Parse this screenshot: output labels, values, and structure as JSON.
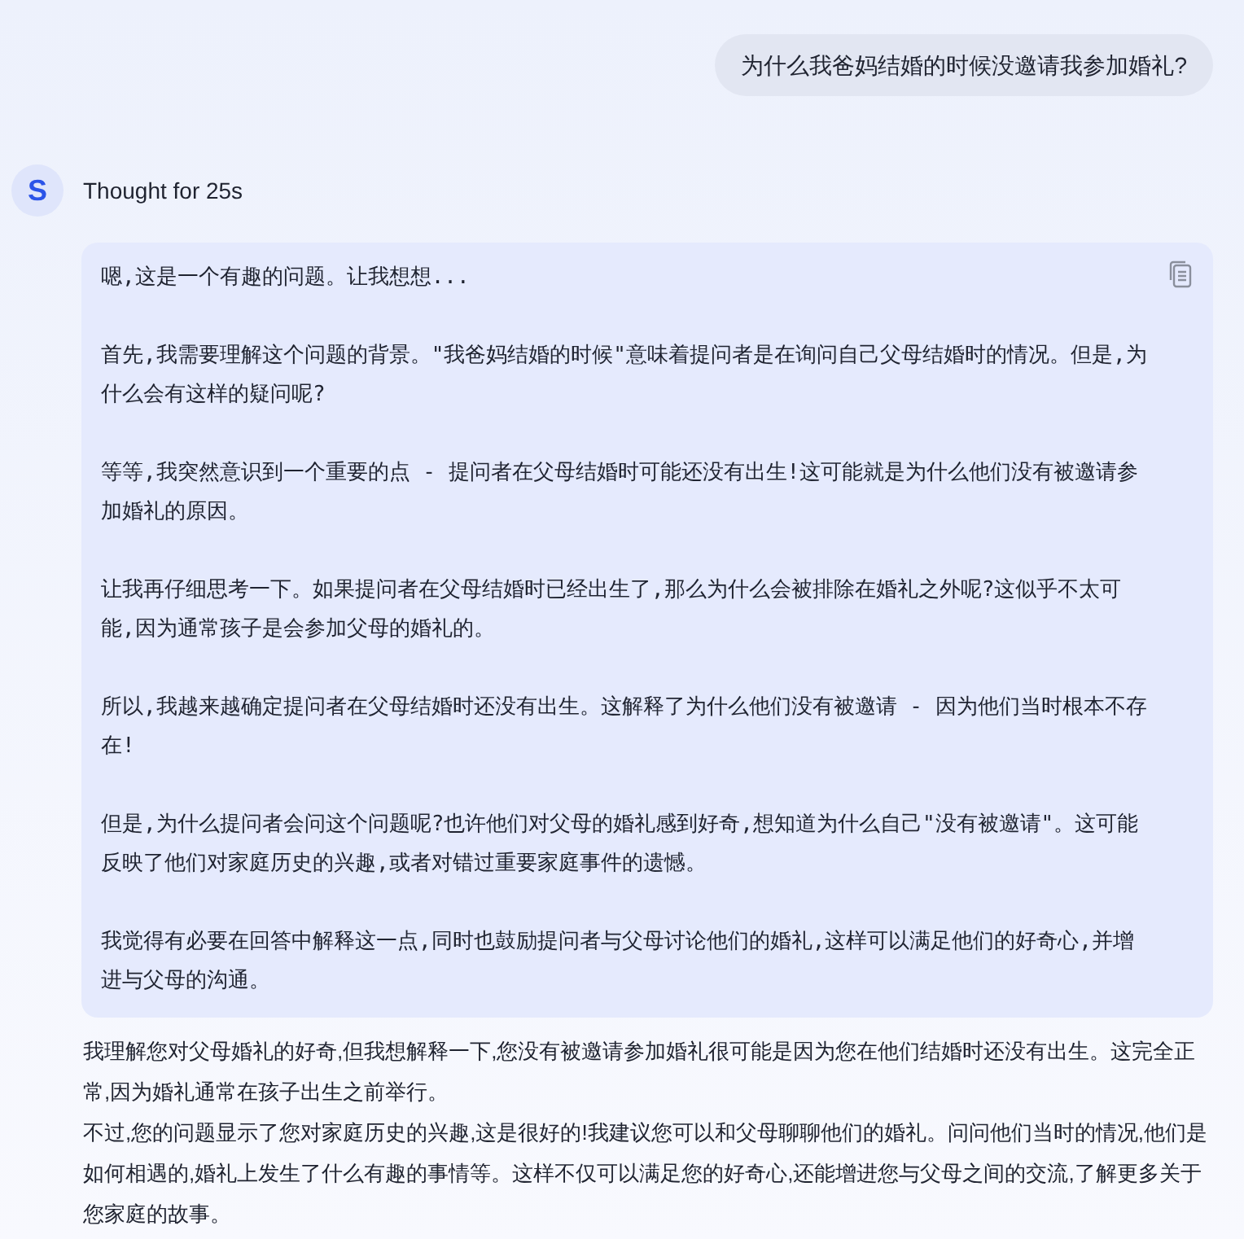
{
  "user_message": "为什么我爸妈结婚的时候没邀请我参加婚礼?",
  "assistant": {
    "avatar": "S",
    "thought_label": "Thought for 25s",
    "thinking": [
      "嗯,这是一个有趣的问题。让我想想...",
      "首先,我需要理解这个问题的背景。\"我爸妈结婚的时候\"意味着提问者是在询问自己父母结婚时的情况。但是,为什么会有这样的疑问呢?",
      "等等,我突然意识到一个重要的点 - 提问者在父母结婚时可能还没有出生!这可能就是为什么他们没有被邀请参加婚礼的原因。",
      "让我再仔细思考一下。如果提问者在父母结婚时已经出生了,那么为什么会被排除在婚礼之外呢?这似乎不太可能,因为通常孩子是会参加父母的婚礼的。",
      "所以,我越来越确定提问者在父母结婚时还没有出生。这解释了为什么他们没有被邀请 - 因为他们当时根本不存在!",
      "但是,为什么提问者会问这个问题呢?也许他们对父母的婚礼感到好奇,想知道为什么自己\"没有被邀请\"。这可能反映了他们对家庭历史的兴趣,或者对错过重要家庭事件的遗憾。",
      "我觉得有必要在回答中解释这一点,同时也鼓励提问者与父母讨论他们的婚礼,这样可以满足他们的好奇心,并增进与父母的沟通。"
    ],
    "answer": [
      "我理解您对父母婚礼的好奇,但我想解释一下,您没有被邀请参加婚礼很可能是因为您在他们结婚时还没有出生。这完全正常,因为婚礼通常在孩子出生之前举行。",
      "不过,您的问题显示了您对家庭历史的兴趣,这是很好的!我建议您可以和父母聊聊他们的婚礼。问问他们当时的情况,他们是如何相遇的,婚礼上发生了什么有趣的事情等。这样不仅可以满足您的好奇心,还能增进您与父母之间的交流,了解更多关于您家庭的故事。"
    ]
  }
}
